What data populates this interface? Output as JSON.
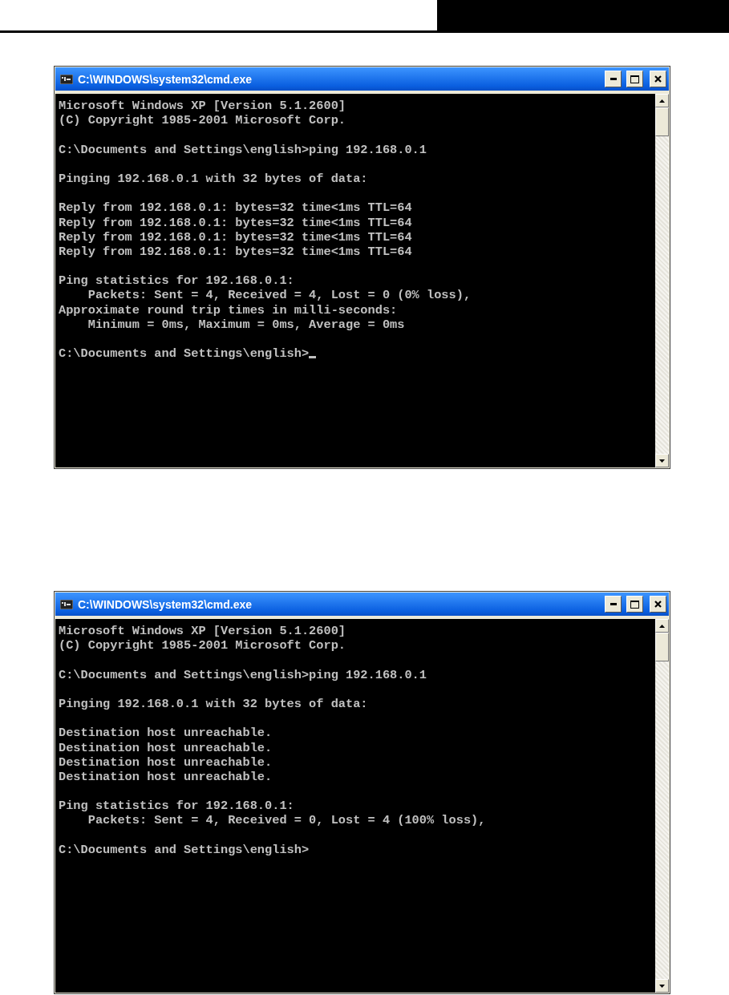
{
  "windows": [
    {
      "title": "C:\\WINDOWS\\system32\\cmd.exe",
      "cursor": true,
      "blocks": [
        [
          "Microsoft Windows XP [Version 5.1.2600]",
          "(C) Copyright 1985-2001 Microsoft Corp."
        ],
        [
          "C:\\Documents and Settings\\english>ping 192.168.0.1"
        ],
        [
          "Pinging 192.168.0.1 with 32 bytes of data:"
        ],
        [
          "Reply from 192.168.0.1: bytes=32 time<1ms TTL=64",
          "Reply from 192.168.0.1: bytes=32 time<1ms TTL=64",
          "Reply from 192.168.0.1: bytes=32 time<1ms TTL=64",
          "Reply from 192.168.0.1: bytes=32 time<1ms TTL=64"
        ],
        [
          "Ping statistics for 192.168.0.1:",
          "    Packets: Sent = 4, Received = 4, Lost = 0 (0% loss),",
          "Approximate round trip times in milli-seconds:",
          "    Minimum = 0ms, Maximum = 0ms, Average = 0ms"
        ],
        [
          "C:\\Documents and Settings\\english>"
        ]
      ]
    },
    {
      "title": "C:\\WINDOWS\\system32\\cmd.exe",
      "cursor": false,
      "blocks": [
        [
          "Microsoft Windows XP [Version 5.1.2600]",
          "(C) Copyright 1985-2001 Microsoft Corp."
        ],
        [
          "C:\\Documents and Settings\\english>ping 192.168.0.1"
        ],
        [
          "Pinging 192.168.0.1 with 32 bytes of data:"
        ],
        [
          "Destination host unreachable.",
          "Destination host unreachable.",
          "Destination host unreachable.",
          "Destination host unreachable."
        ],
        [
          "Ping statistics for 192.168.0.1:",
          "    Packets: Sent = 4, Received = 0, Lost = 4 (100% loss),"
        ],
        [
          "C:\\Documents and Settings\\english>"
        ]
      ]
    }
  ]
}
